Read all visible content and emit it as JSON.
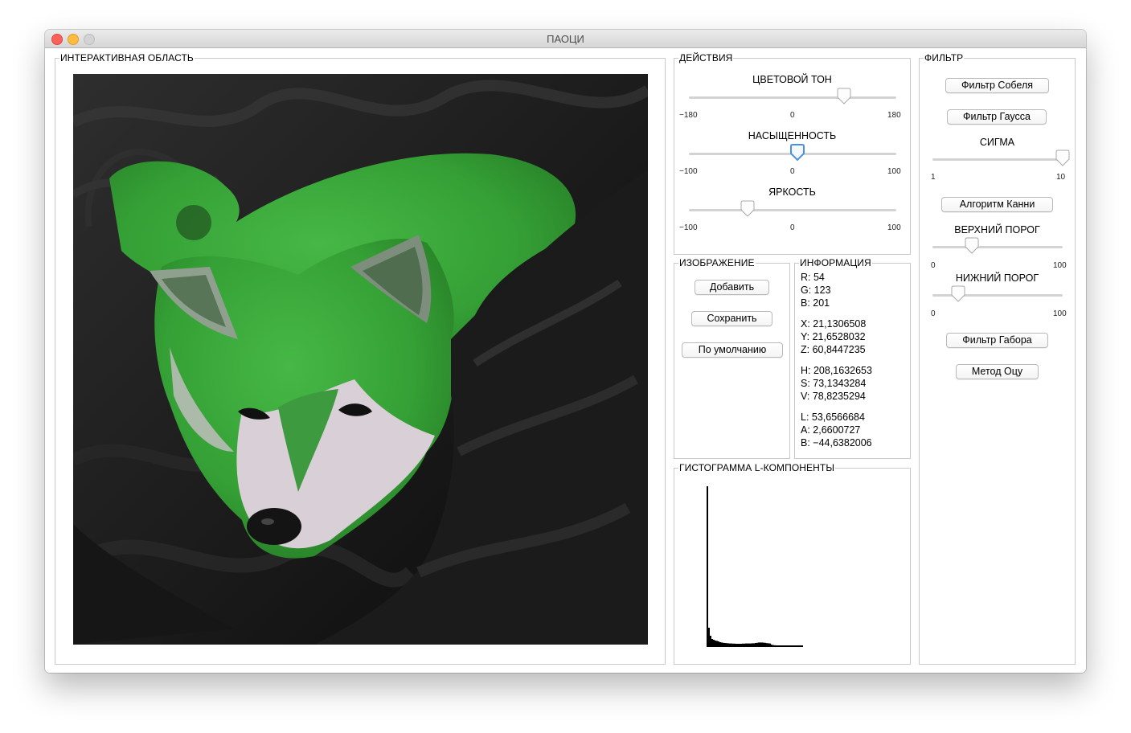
{
  "window": {
    "title": "ПАОЦИ"
  },
  "interactive": {
    "legend": "ИНТЕРАКТИВНАЯ ОБЛАСТЬ"
  },
  "actions": {
    "legend": "ДЕЙСТВИЯ",
    "hue": {
      "label": "ЦВЕТОВОЙ ТОН",
      "min": "−180",
      "mid": "0",
      "max": "180",
      "value": 95
    },
    "saturation": {
      "label": "НАСЫЩЕННОСТЬ",
      "min": "−100",
      "mid": "0",
      "max": "100",
      "value": 5
    },
    "brightness": {
      "label": "ЯРКОСТЬ",
      "min": "−100",
      "mid": "0",
      "max": "100",
      "value": -45
    }
  },
  "image": {
    "legend": "ИЗОБРАЖЕНИЕ",
    "add": "Добавить",
    "save": "Сохранить",
    "default": "По умолчанию"
  },
  "info": {
    "legend": "ИНФОРМАЦИЯ",
    "r": "R: 54",
    "g": "G: 123",
    "b": "B: 201",
    "x": "X: 21,1306508",
    "y": "Y: 21,6528032",
    "z": "Z: 60,8447235",
    "h": "H: 208,1632653",
    "s": "S: 73,1343284",
    "v": "V: 78,8235294",
    "l": "L: 53,6566684",
    "a": "A: 2,6600727",
    "lab_b": "B: −44,6382006"
  },
  "histogram": {
    "legend": "ГИСТОГРАММА L-КОМПОНЕНТЫ",
    "bins": [
      100,
      12,
      7,
      5,
      4.5,
      4,
      3.8,
      3.5,
      3,
      2.8,
      2.6,
      2.5,
      2.4,
      2.3,
      2.2,
      2.2,
      2.1,
      2.1,
      2,
      2,
      2,
      2,
      2.1,
      2.1,
      2.2,
      2.2,
      2.2,
      2.2,
      2.3,
      2.3,
      2.5,
      2.6,
      2.8,
      2.8,
      2.8,
      2.7,
      2.6,
      2.4,
      2.3,
      2.2,
      1.5,
      1.2,
      1.1,
      1,
      1,
      1,
      1,
      1,
      1,
      1,
      1,
      1,
      1,
      1,
      1,
      1,
      1,
      1,
      1,
      1
    ]
  },
  "filter": {
    "legend": "ФИЛЬТР",
    "sobel": "Фильтр Собеля",
    "gauss": "Фильтр Гаусса",
    "sigma": {
      "label": "СИГМА",
      "min": "1",
      "max": "10",
      "value": 10
    },
    "canny": "Алгоритм Канни",
    "upper": {
      "label": "ВЕРХНИЙ ПОРОГ",
      "min": "0",
      "max": "100",
      "value": 30
    },
    "lower": {
      "label": "НИЖНИЙ ПОРОГ",
      "min": "0",
      "max": "100",
      "value": 20
    },
    "gabor": "Фильтр Габора",
    "otsu": "Метод Оцу"
  },
  "colors": {
    "accent": "#4a90e2",
    "fur_green": "#3aa63a"
  }
}
